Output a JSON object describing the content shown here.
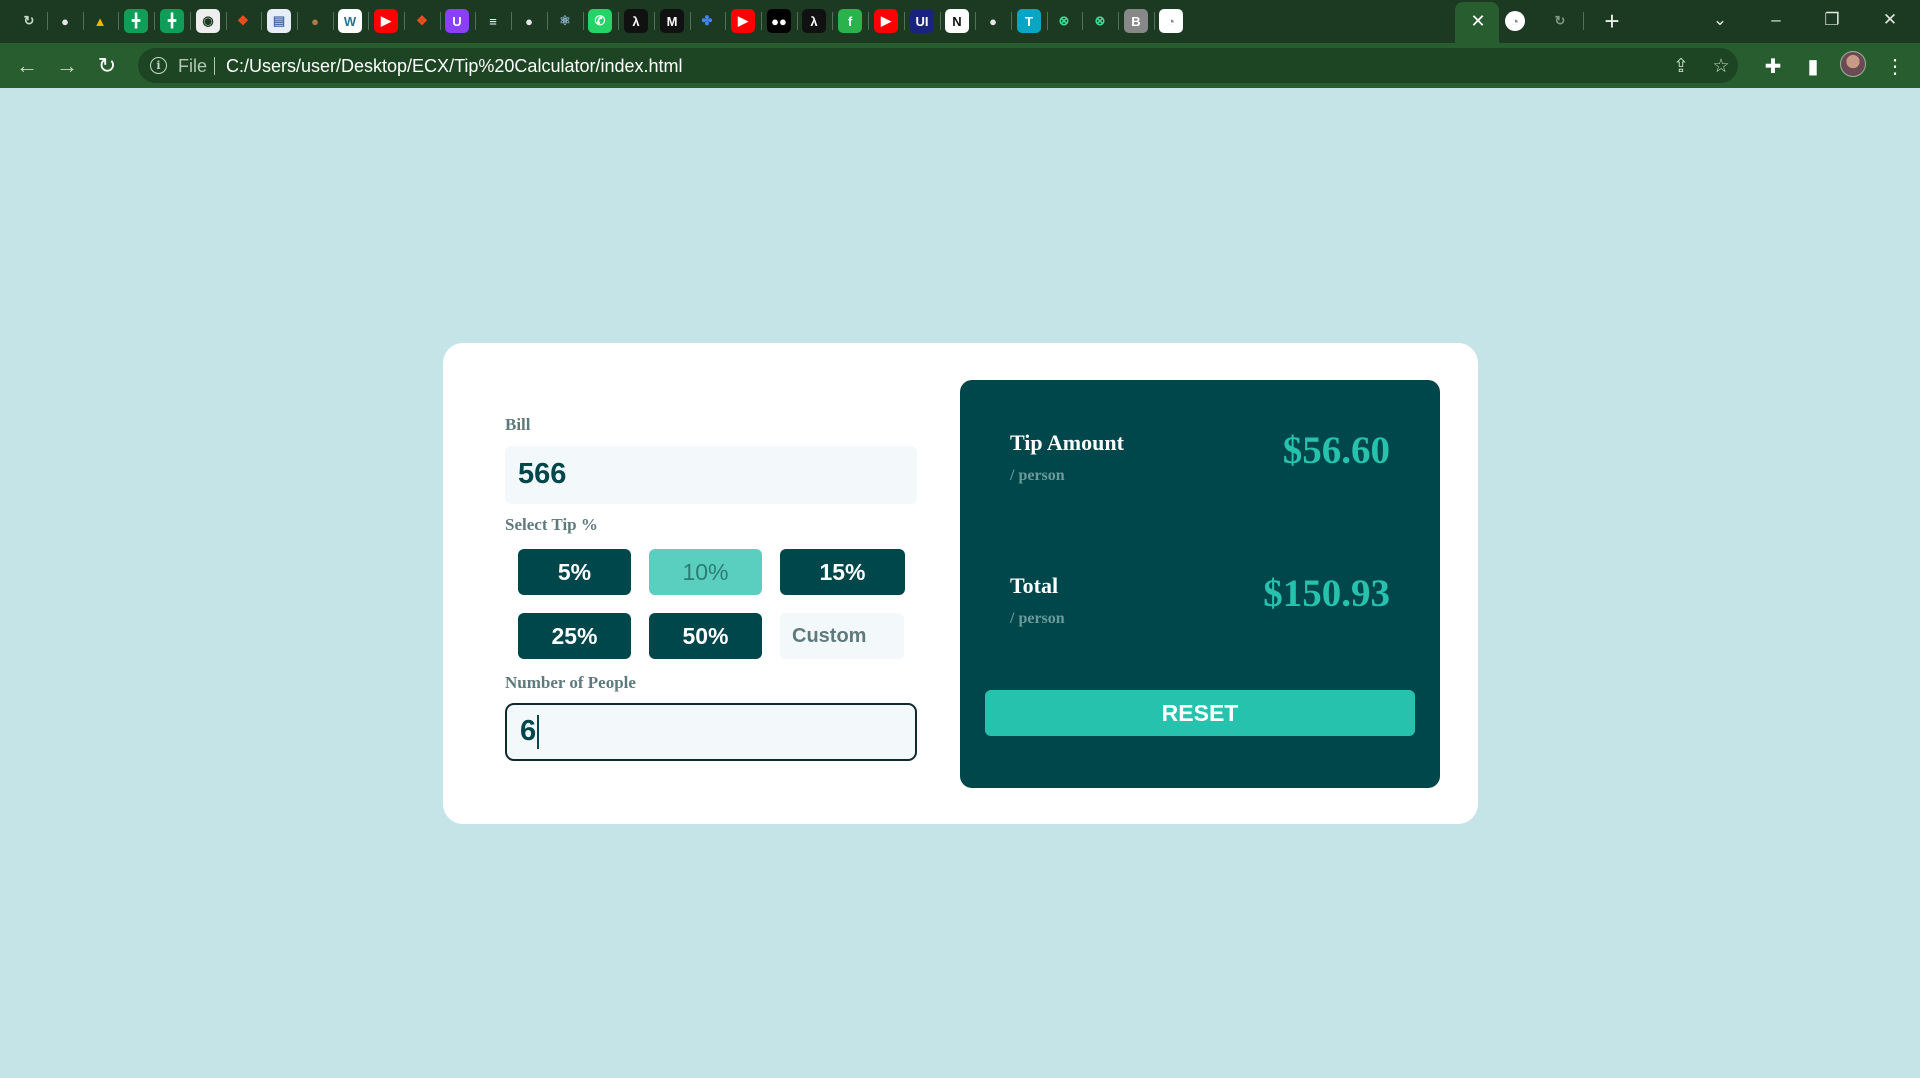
{
  "browser": {
    "omnibox": {
      "scheme_label": "File",
      "url": "C:/Users/user/Desktop/ECX/Tip%20Calculator/index.html"
    },
    "tab_icons": [
      {
        "icon": "page-icon",
        "glyph": "↻",
        "bg": "#1b3a21",
        "color": "#c9d9c9"
      },
      {
        "icon": "globe-icon",
        "glyph": "●",
        "bg": "#1b3a21",
        "color": "#e6e6e6"
      },
      {
        "icon": "drive-icon",
        "glyph": "▲",
        "bg": "#1b3a21",
        "color": "#f4b400"
      },
      {
        "icon": "sheets-icon",
        "glyph": "╋",
        "bg": "#0f9d58",
        "color": "#ffffff"
      },
      {
        "icon": "sheets-icon",
        "glyph": "╋",
        "bg": "#0f9d58",
        "color": "#ffffff"
      },
      {
        "icon": "profile-icon",
        "glyph": "◉",
        "bg": "#eeeeee",
        "color": "#1b3a21"
      },
      {
        "icon": "figma-icon",
        "glyph": "❖",
        "bg": "#1b3a21",
        "color": "#f24e1e"
      },
      {
        "icon": "docs-icon",
        "glyph": "▤",
        "bg": "#e8eef8",
        "color": "#4a6ea9"
      },
      {
        "icon": "avatar-icon",
        "glyph": "●",
        "bg": "#1b3a21",
        "color": "#b07a4a"
      },
      {
        "icon": "wordpress-icon",
        "glyph": "W",
        "bg": "#ffffff",
        "color": "#21759b"
      },
      {
        "icon": "youtube-icon",
        "glyph": "▶",
        "bg": "#ff0000",
        "color": "#ffffff"
      },
      {
        "icon": "figma-icon",
        "glyph": "❖",
        "bg": "#1b3a21",
        "color": "#f24e1e"
      },
      {
        "icon": "u-icon",
        "glyph": "U",
        "bg": "#8a3ffc",
        "color": "#ffffff"
      },
      {
        "icon": "bars-icon",
        "glyph": "≡",
        "bg": "#1b3a21",
        "color": "#ffffff"
      },
      {
        "icon": "globe-icon",
        "glyph": "●",
        "bg": "#1b3a21",
        "color": "#e6e6e6"
      },
      {
        "icon": "react-icon",
        "glyph": "⚛",
        "bg": "#1b3a21",
        "color": "#8fb3c9"
      },
      {
        "icon": "whatsapp-icon",
        "glyph": "✆",
        "bg": "#25d366",
        "color": "#ffffff"
      },
      {
        "icon": "lambda-icon",
        "glyph": "λ",
        "bg": "#111111",
        "color": "#ffffff"
      },
      {
        "icon": "m-icon",
        "glyph": "M",
        "bg": "#111111",
        "color": "#ffffff"
      },
      {
        "icon": "colorful-icon",
        "glyph": "✤",
        "bg": "#1b3a21",
        "color": "#4285f4"
      },
      {
        "icon": "youtube-icon",
        "glyph": "▶",
        "bg": "#ff0000",
        "color": "#ffffff"
      },
      {
        "icon": "medium-icon",
        "glyph": "●●",
        "bg": "#000000",
        "color": "#ffffff"
      },
      {
        "icon": "lambda-icon",
        "glyph": "λ",
        "bg": "#111111",
        "color": "#ffffff"
      },
      {
        "icon": "feedly-icon",
        "glyph": "f",
        "bg": "#2bb24c",
        "color": "#ffffff"
      },
      {
        "icon": "youtube-icon",
        "glyph": "▶",
        "bg": "#ff0000",
        "color": "#ffffff"
      },
      {
        "icon": "ui-icon",
        "glyph": "UI",
        "bg": "#1a237e",
        "color": "#ffffff"
      },
      {
        "icon": "notion-icon",
        "glyph": "N",
        "bg": "#ffffff",
        "color": "#111111"
      },
      {
        "icon": "globe-icon",
        "glyph": "●",
        "bg": "#1b3a21",
        "color": "#e6e6e6"
      },
      {
        "icon": "t-icon",
        "glyph": "T",
        "bg": "#0aa5c2",
        "color": "#ffffff"
      },
      {
        "icon": "gem-icon",
        "glyph": "⊗",
        "bg": "#1b3a21",
        "color": "#3ddc97"
      },
      {
        "icon": "gem-icon",
        "glyph": "⊗",
        "bg": "#1b3a21",
        "color": "#3ddc97"
      },
      {
        "icon": "b-icon",
        "glyph": "B",
        "bg": "#888888",
        "color": "#ffffff"
      },
      {
        "icon": "clock-icon",
        "glyph": "◔",
        "bg": "#ffffff",
        "color": "#888888"
      }
    ]
  },
  "app": {
    "bill": {
      "label": "Bill",
      "value": "566"
    },
    "select_tip": {
      "label": "Select Tip %",
      "options": [
        "5%",
        "10%",
        "15%",
        "25%",
        "50%"
      ],
      "selected": "10%",
      "custom_placeholder": "Custom"
    },
    "people": {
      "label": "Number of People",
      "value": "6"
    },
    "tip_amount": {
      "title": "Tip Amount",
      "sub": "/ person",
      "value": "$56.60"
    },
    "total": {
      "title": "Total",
      "sub": "/ person",
      "value": "$150.93"
    },
    "reset_label": "RESET"
  },
  "colors": {
    "page_bg": "#c5e4e7",
    "dark_cyan": "#00474b",
    "strong_cyan": "#26c2ad",
    "selected_tip": "#5bcfbf"
  }
}
